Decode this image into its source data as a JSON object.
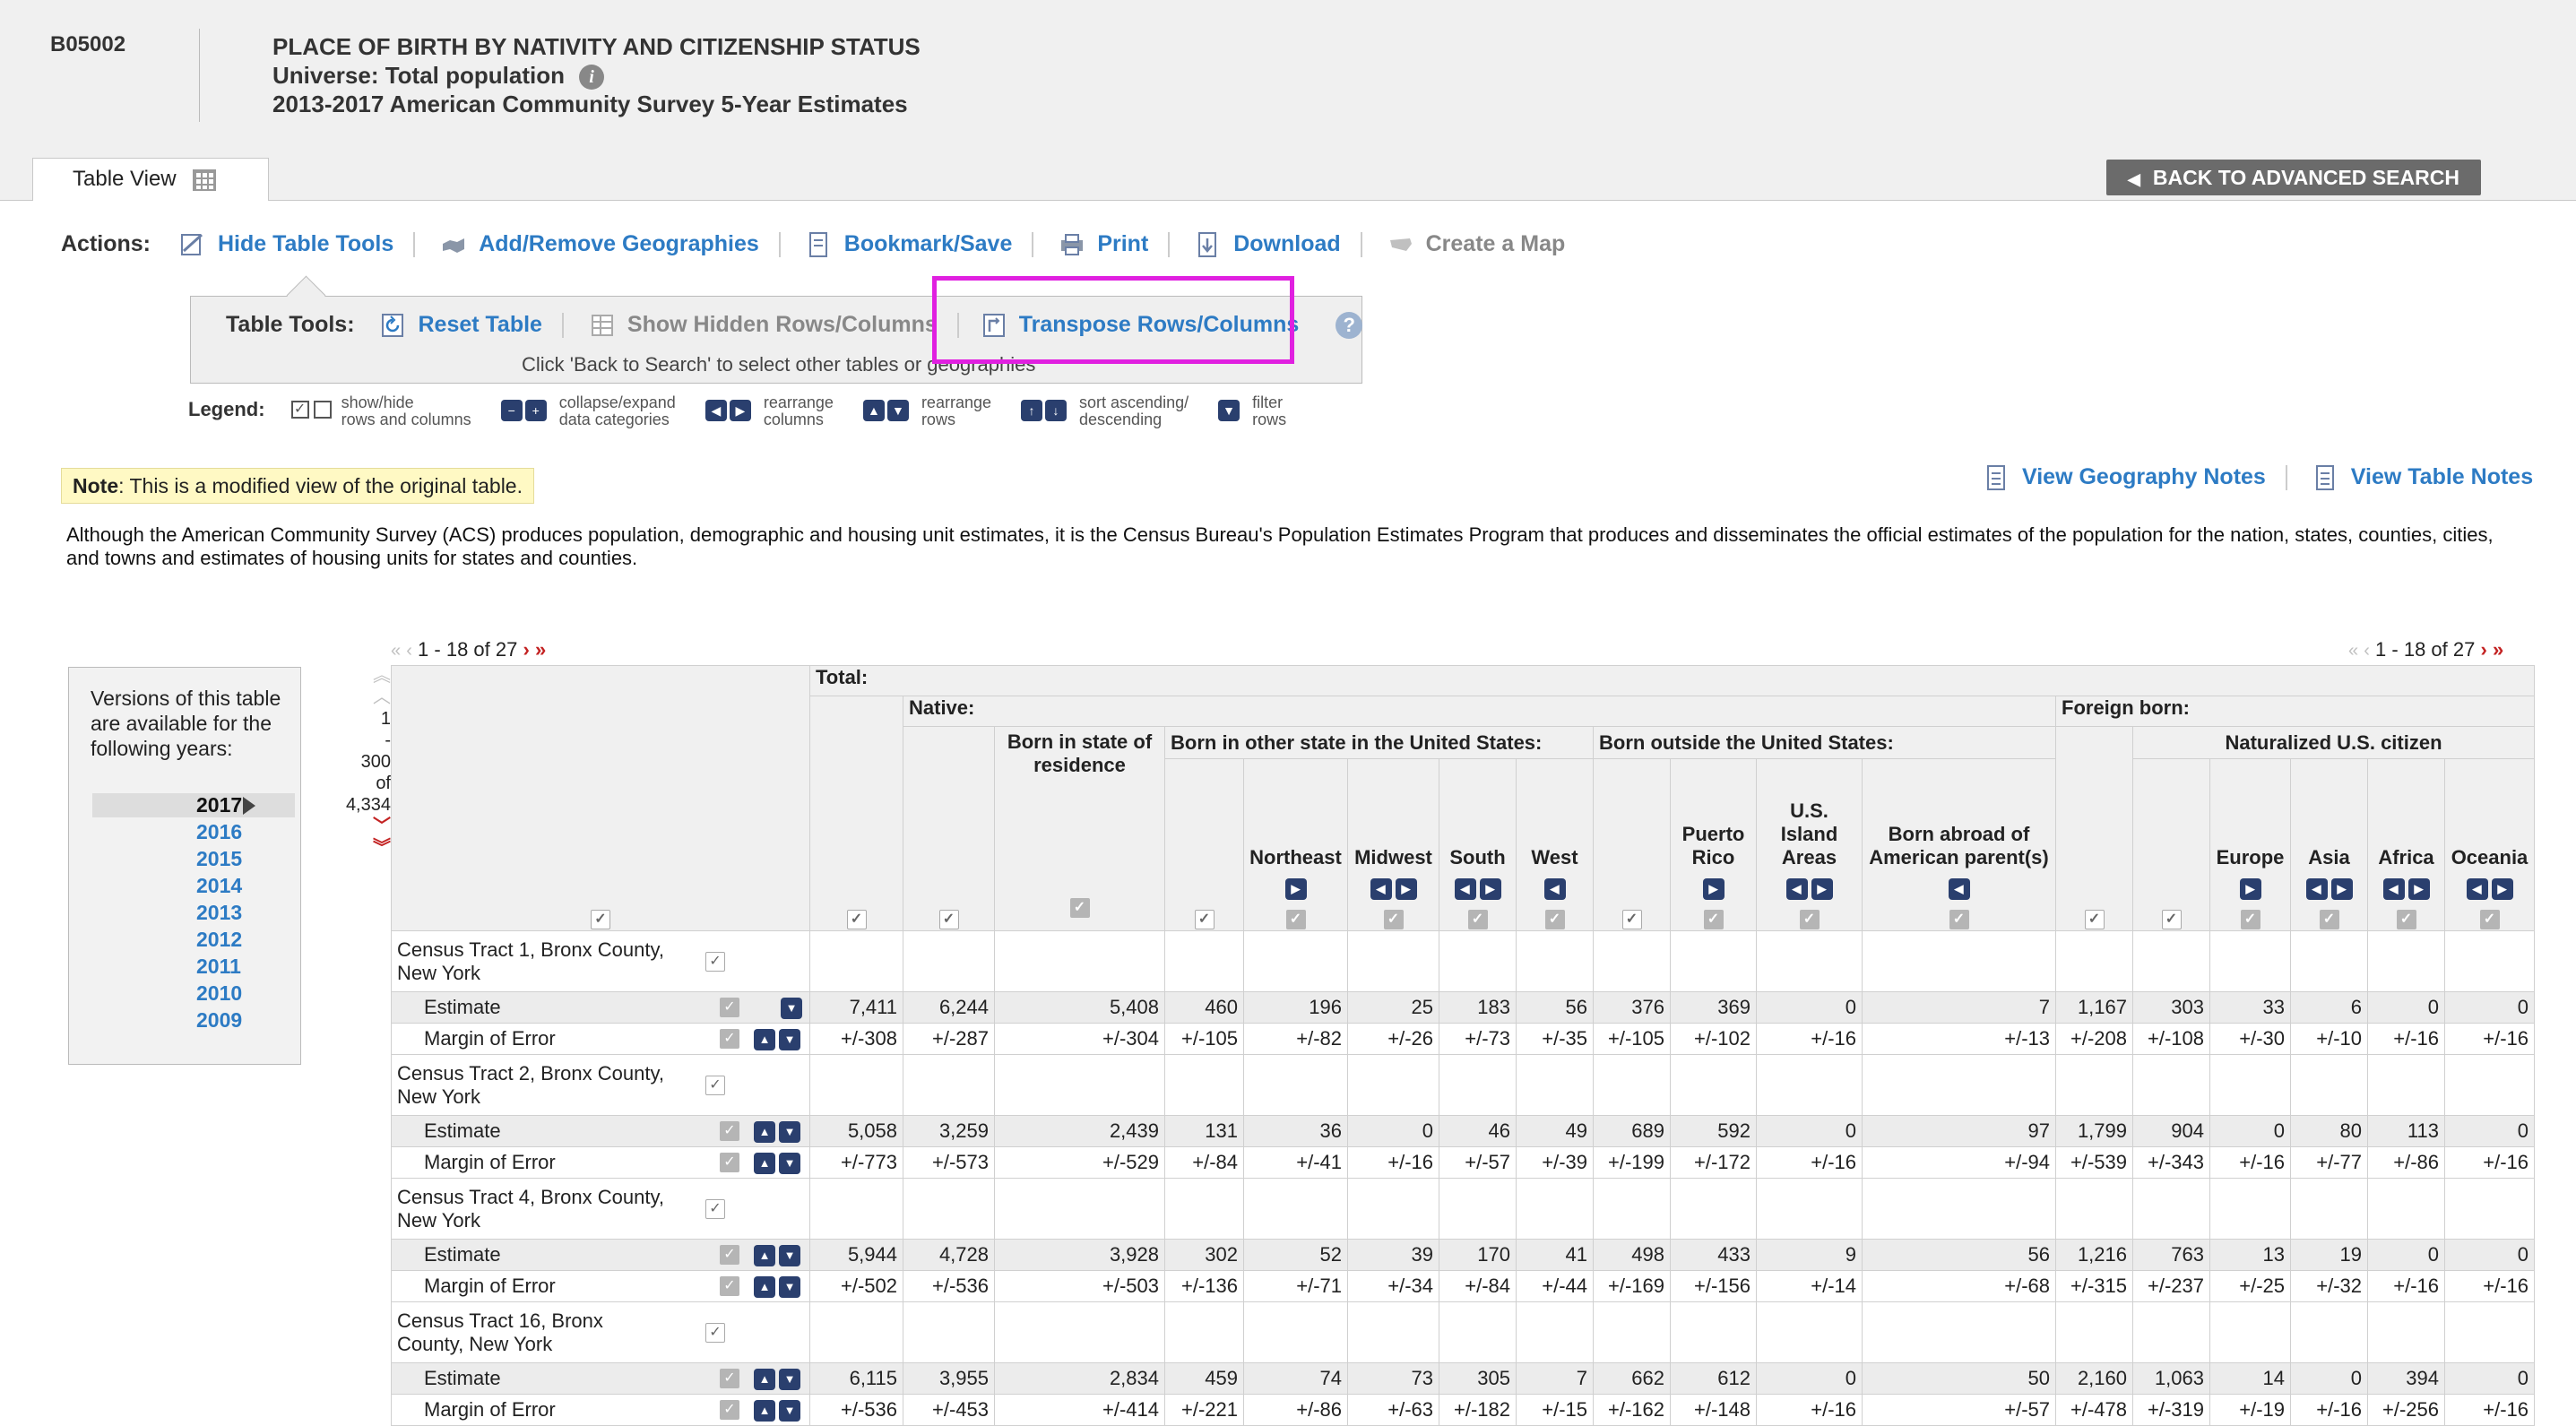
{
  "header": {
    "table_id": "B05002",
    "title": "PLACE OF BIRTH BY NATIVITY AND CITIZENSHIP STATUS",
    "universe": "Universe: Total population",
    "survey": "2013-2017 American Community Survey 5-Year Estimates",
    "tab_label": "Table View",
    "back_label": "BACK TO ADVANCED SEARCH"
  },
  "actions": {
    "label": "Actions:",
    "items": [
      "Hide Table Tools",
      "Add/Remove Geographies",
      "Bookmark/Save",
      "Print",
      "Download",
      "Create a Map"
    ]
  },
  "tools": {
    "label": "Table Tools:",
    "reset": "Reset Table",
    "show_hidden": "Show Hidden Rows/Columns",
    "transpose": "Transpose Rows/Columns",
    "hint": "Click 'Back to Search' to select other tables or geographies"
  },
  "legend": {
    "label": "Legend:",
    "items": [
      [
        "show/hide",
        "rows and columns"
      ],
      [
        "collapse/expand",
        "data categories"
      ],
      [
        "rearrange",
        "columns"
      ],
      [
        "rearrange",
        "rows"
      ],
      [
        "sort ascending/",
        "descending"
      ],
      [
        "filter",
        "rows"
      ]
    ]
  },
  "note": {
    "prefix": "Note",
    "text": ": This is a modified view of the original table."
  },
  "notes_links": {
    "geography": "View Geography Notes",
    "table": "View Table Notes"
  },
  "disclaimer": "Although the American Community Survey (ACS) produces population, demographic and housing unit estimates, it is the Census Bureau's Population Estimates Program that produces and disseminates the official estimates of the population for the nation, states, counties, cities, and towns and estimates of housing units for states and counties.",
  "versions": {
    "title": "Versions of this table are available for the following years:",
    "years": [
      "2017",
      "2016",
      "2015",
      "2014",
      "2013",
      "2012",
      "2011",
      "2010",
      "2009"
    ],
    "selected": "2017"
  },
  "pager": {
    "columns": "1 - 18 of 27",
    "rows": [
      "1",
      "-",
      "300",
      "of",
      "4,334"
    ]
  },
  "table": {
    "h_total": "Total:",
    "h_native": "Native:",
    "h_foreign": "Foreign born:",
    "h_born_state": "Born in state of residence",
    "h_other_state": "Born in other state in the United States:",
    "h_outside": "Born outside the United States:",
    "h_naturalized": "Naturalized U.S. citizen",
    "h_northeast": "Northeast",
    "h_midwest": "Midwest",
    "h_south": "South",
    "h_west": "West",
    "h_puerto": "Puerto Rico",
    "h_island": "U.S. Island Areas",
    "h_abroad": "Born abroad of American parent(s)",
    "h_europe": "Europe",
    "h_asia": "Asia",
    "h_africa": "Africa",
    "h_oceania": "Oceania",
    "geos": [
      {
        "name": "Census Tract 1, Bronx County, New York",
        "estimate": [
          "7,411",
          "6,244",
          "5,408",
          "460",
          "196",
          "25",
          "183",
          "56",
          "376",
          "369",
          "0",
          "7",
          "1,167",
          "303",
          "33",
          "6",
          "0",
          "0"
        ],
        "moe": [
          "+/-308",
          "+/-287",
          "+/-304",
          "+/-105",
          "+/-82",
          "+/-26",
          "+/-73",
          "+/-35",
          "+/-105",
          "+/-102",
          "+/-16",
          "+/-13",
          "+/-208",
          "+/-108",
          "+/-30",
          "+/-10",
          "+/-16",
          "+/-16"
        ]
      },
      {
        "name": "Census Tract 2, Bronx County, New York",
        "estimate": [
          "5,058",
          "3,259",
          "2,439",
          "131",
          "36",
          "0",
          "46",
          "49",
          "689",
          "592",
          "0",
          "97",
          "1,799",
          "904",
          "0",
          "80",
          "113",
          "0"
        ],
        "moe": [
          "+/-773",
          "+/-573",
          "+/-529",
          "+/-84",
          "+/-41",
          "+/-16",
          "+/-57",
          "+/-39",
          "+/-199",
          "+/-172",
          "+/-16",
          "+/-94",
          "+/-539",
          "+/-343",
          "+/-16",
          "+/-77",
          "+/-86",
          "+/-16"
        ]
      },
      {
        "name": "Census Tract 4, Bronx County, New York",
        "estimate": [
          "5,944",
          "4,728",
          "3,928",
          "302",
          "52",
          "39",
          "170",
          "41",
          "498",
          "433",
          "9",
          "56",
          "1,216",
          "763",
          "13",
          "19",
          "0",
          "0"
        ],
        "moe": [
          "+/-502",
          "+/-536",
          "+/-503",
          "+/-136",
          "+/-71",
          "+/-34",
          "+/-84",
          "+/-44",
          "+/-169",
          "+/-156",
          "+/-14",
          "+/-68",
          "+/-315",
          "+/-237",
          "+/-25",
          "+/-32",
          "+/-16",
          "+/-16"
        ]
      },
      {
        "name": "Census Tract 16, Bronx County, New York",
        "estimate": [
          "6,115",
          "3,955",
          "2,834",
          "459",
          "74",
          "73",
          "305",
          "7",
          "662",
          "612",
          "0",
          "50",
          "2,160",
          "1,063",
          "14",
          "0",
          "394",
          "0"
        ],
        "moe": [
          "+/-536",
          "+/-453",
          "+/-414",
          "+/-221",
          "+/-86",
          "+/-63",
          "+/-182",
          "+/-15",
          "+/-162",
          "+/-148",
          "+/-16",
          "+/-57",
          "+/-478",
          "+/-319",
          "+/-19",
          "+/-16",
          "+/-256",
          "+/-16"
        ]
      }
    ],
    "row_labels": {
      "estimate": "Estimate",
      "moe": "Margin of Error"
    }
  },
  "colors": {
    "link": "#2d7bc4",
    "highlight": "#e020e0",
    "nav_button": "#2a3f6e"
  }
}
